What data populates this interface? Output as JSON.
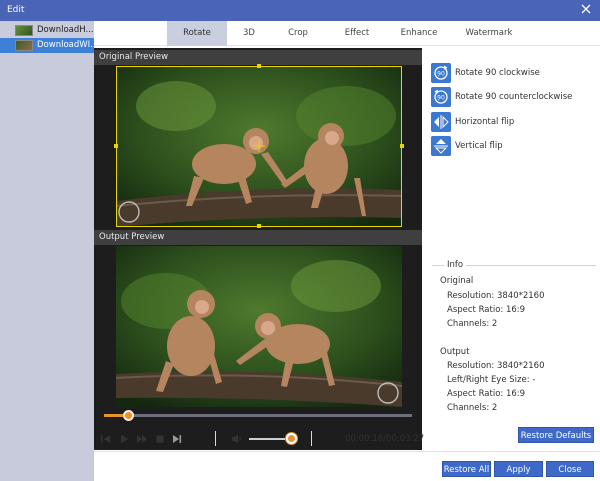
{
  "window": {
    "title": "Edit"
  },
  "files": [
    {
      "name": "DownloadH...",
      "selected": false
    },
    {
      "name": "DownloadWI...",
      "selected": true
    }
  ],
  "tabs": [
    "Rotate",
    "3D",
    "Crop",
    "Effect",
    "Enhance",
    "Watermark"
  ],
  "active_tab": "Rotate",
  "preview": {
    "original_label": "Original Preview",
    "output_label": "Output Preview"
  },
  "playback": {
    "current_time": "00:00:16",
    "total_time": "00:03:27",
    "time_display": "00:00:16/00:03:27",
    "progress": 0.08,
    "volume": 0.85
  },
  "rotate_ops": [
    {
      "label": "Rotate 90 clockwise",
      "icon": "rotate-clockwise-icon"
    },
    {
      "label": "Rotate 90 counterclockwise",
      "icon": "rotate-counterclockwise-icon"
    },
    {
      "label": "Horizontal flip",
      "icon": "horizontal-flip-icon"
    },
    {
      "label": "Vertical flip",
      "icon": "vertical-flip-icon"
    }
  ],
  "info": {
    "legend": "Info",
    "original": {
      "heading": "Original",
      "resolution": "Resolution: 3840*2160",
      "aspect": "Aspect Ratio: 16:9",
      "channels": "Channels: 2"
    },
    "output": {
      "heading": "Output",
      "resolution": "Resolution: 3840*2160",
      "eye": "Left/Right Eye Size: -",
      "aspect": "Aspect Ratio: 16:9",
      "channels": "Channels: 2"
    }
  },
  "buttons": {
    "restore_defaults": "Restore Defaults",
    "restore_all": "Restore All",
    "apply": "Apply",
    "close": "Close"
  },
  "colors": {
    "titlebar": "#4a65b8",
    "accent": "#3e69c8",
    "progress": "#e8922d",
    "crop_frame": "#e8d400"
  }
}
